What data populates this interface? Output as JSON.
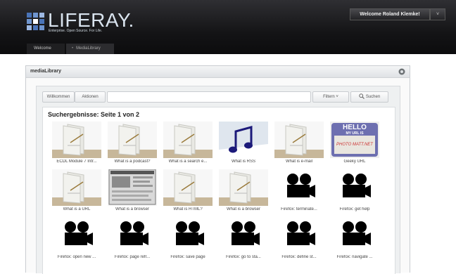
{
  "header": {
    "logo_text": "LIFERAY.",
    "tagline": "Enterprise. Open Source. For Life.",
    "welcome_label": "Welcome Roland Klemke!",
    "welcome_caret": "˅"
  },
  "nav": {
    "items": [
      {
        "label": "Welcome"
      },
      {
        "label": "MediaLibrary"
      }
    ]
  },
  "portlet": {
    "title": "mediaLibrary"
  },
  "toolbar": {
    "home_label": "Willkommen",
    "actions_label": "Aktionen",
    "filter_label": "Filtern ˅",
    "search_label": "Suchen",
    "search_value": ""
  },
  "results": {
    "title": "Suchergebnisse: Seite 1 von 2",
    "items": [
      {
        "label": "ECDL Module 7 Intr...",
        "thumb": "document-icon"
      },
      {
        "label": "What is a podcast?",
        "thumb": "document-icon"
      },
      {
        "label": "What is a search e...",
        "thumb": "document-icon"
      },
      {
        "label": "What is RSS",
        "thumb": "music-note-icon"
      },
      {
        "label": "What is e-mail",
        "thumb": "document-icon"
      },
      {
        "label": "Geeky URL",
        "thumb": "hello-badge-image"
      },
      {
        "label": "What is a URL",
        "thumb": "document-icon"
      },
      {
        "label": "What is a browser",
        "thumb": "screenshot-image"
      },
      {
        "label": "What is HTML?",
        "thumb": "document-icon"
      },
      {
        "label": "What is a browser",
        "thumb": "document-icon"
      },
      {
        "label": "Firefox: terminate...",
        "thumb": "video-camera-icon"
      },
      {
        "label": "Firefox: get help",
        "thumb": "video-camera-icon"
      },
      {
        "label": "Firefox: open new ...",
        "thumb": "video-camera-icon"
      },
      {
        "label": "Firefox: page refr...",
        "thumb": "video-camera-icon"
      },
      {
        "label": "Firefox: save page",
        "thumb": "video-camera-icon"
      },
      {
        "label": "Firefox: go to sta...",
        "thumb": "video-camera-icon"
      },
      {
        "label": "Firefox: define st...",
        "thumb": "video-camera-icon"
      },
      {
        "label": "Firefox: navigate ...",
        "thumb": "video-camera-icon"
      }
    ],
    "badge_line1": "HELLO",
    "badge_line2": "MY URL IS",
    "badge_line3": "PHOTO MATT.NET"
  },
  "colors": {
    "header_bg": "#141416",
    "accent": "#6f8fb5",
    "video_icon": "#000000"
  }
}
